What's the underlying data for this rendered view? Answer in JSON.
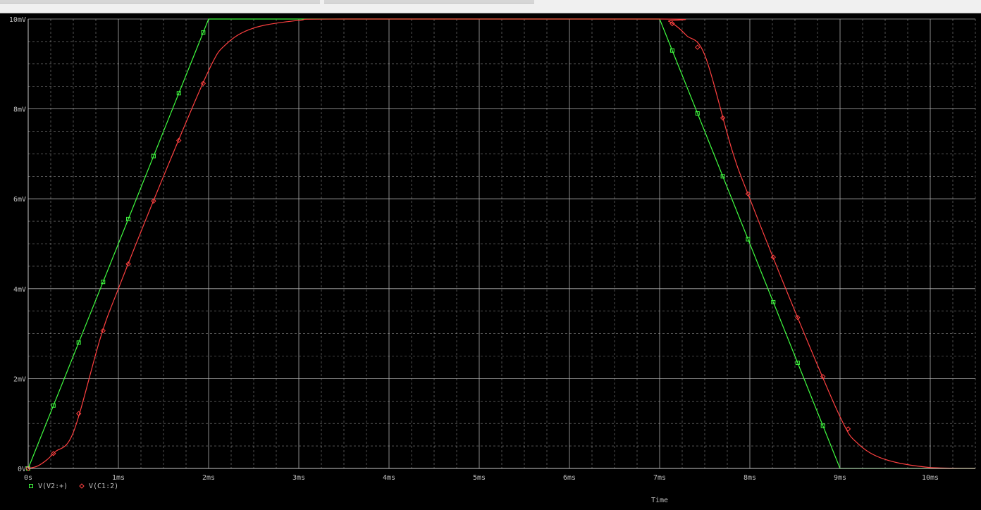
{
  "chart_data": {
    "type": "line",
    "xlabel": "Time",
    "ylabel": "",
    "xlim": [
      0,
      10.5
    ],
    "ylim": [
      0,
      10
    ],
    "x_unit": "ms",
    "y_unit": "mV",
    "x_ticks": [
      0,
      1,
      2,
      3,
      4,
      5,
      6,
      7,
      8,
      9,
      10
    ],
    "x_tick_labels": [
      "0s",
      "1ms",
      "2ms",
      "3ms",
      "4ms",
      "5ms",
      "6ms",
      "7ms",
      "8ms",
      "9ms",
      "10ms"
    ],
    "y_ticks": [
      0,
      2,
      4,
      6,
      8,
      10
    ],
    "y_tick_labels": [
      "0V",
      "2mV",
      "4mV",
      "6mV",
      "8mV",
      "10mV"
    ],
    "grid": true,
    "grid_minor": true,
    "legend_position": "bottom-left",
    "background_color": "#000000",
    "grid_color": "#c0c0c0",
    "axis_text_color": "#c0c0c0",
    "series": [
      {
        "name": "V(V2:+)",
        "color": "#40ff40",
        "marker": "square",
        "x": [
          0,
          2,
          7,
          9,
          10.5
        ],
        "y": [
          0,
          10,
          10,
          0,
          0
        ],
        "marker_x": [
          0,
          0.28,
          0.56,
          0.83,
          1.11,
          1.39,
          1.67,
          1.94,
          7.14,
          7.42,
          7.7,
          7.98,
          8.26,
          8.53,
          8.81
        ]
      },
      {
        "name": "V(C1:2)",
        "color": "#ff4040",
        "marker": "diamond",
        "x": [
          0,
          0.1,
          0.2,
          0.3,
          0.5,
          0.8,
          1,
          1.5,
          2,
          2.2,
          2.5,
          3,
          3.5,
          7,
          7.1,
          7.2,
          7.3,
          7.5,
          7.8,
          8,
          8.5,
          9,
          9.2,
          9.5,
          10,
          10.5
        ],
        "y": [
          0,
          0.05,
          0.18,
          0.37,
          0.8,
          2.9,
          4,
          6.5,
          8.85,
          9.45,
          9.8,
          9.97,
          10,
          10,
          9.95,
          9.82,
          9.63,
          9.2,
          7.1,
          6,
          3.5,
          1.15,
          0.55,
          0.2,
          0.02,
          0
        ],
        "marker_x": [
          0,
          0.28,
          0.56,
          0.83,
          1.11,
          1.39,
          1.67,
          1.94,
          7.14,
          7.42,
          7.7,
          7.98,
          8.26,
          8.53,
          8.81,
          9.09
        ]
      }
    ]
  }
}
